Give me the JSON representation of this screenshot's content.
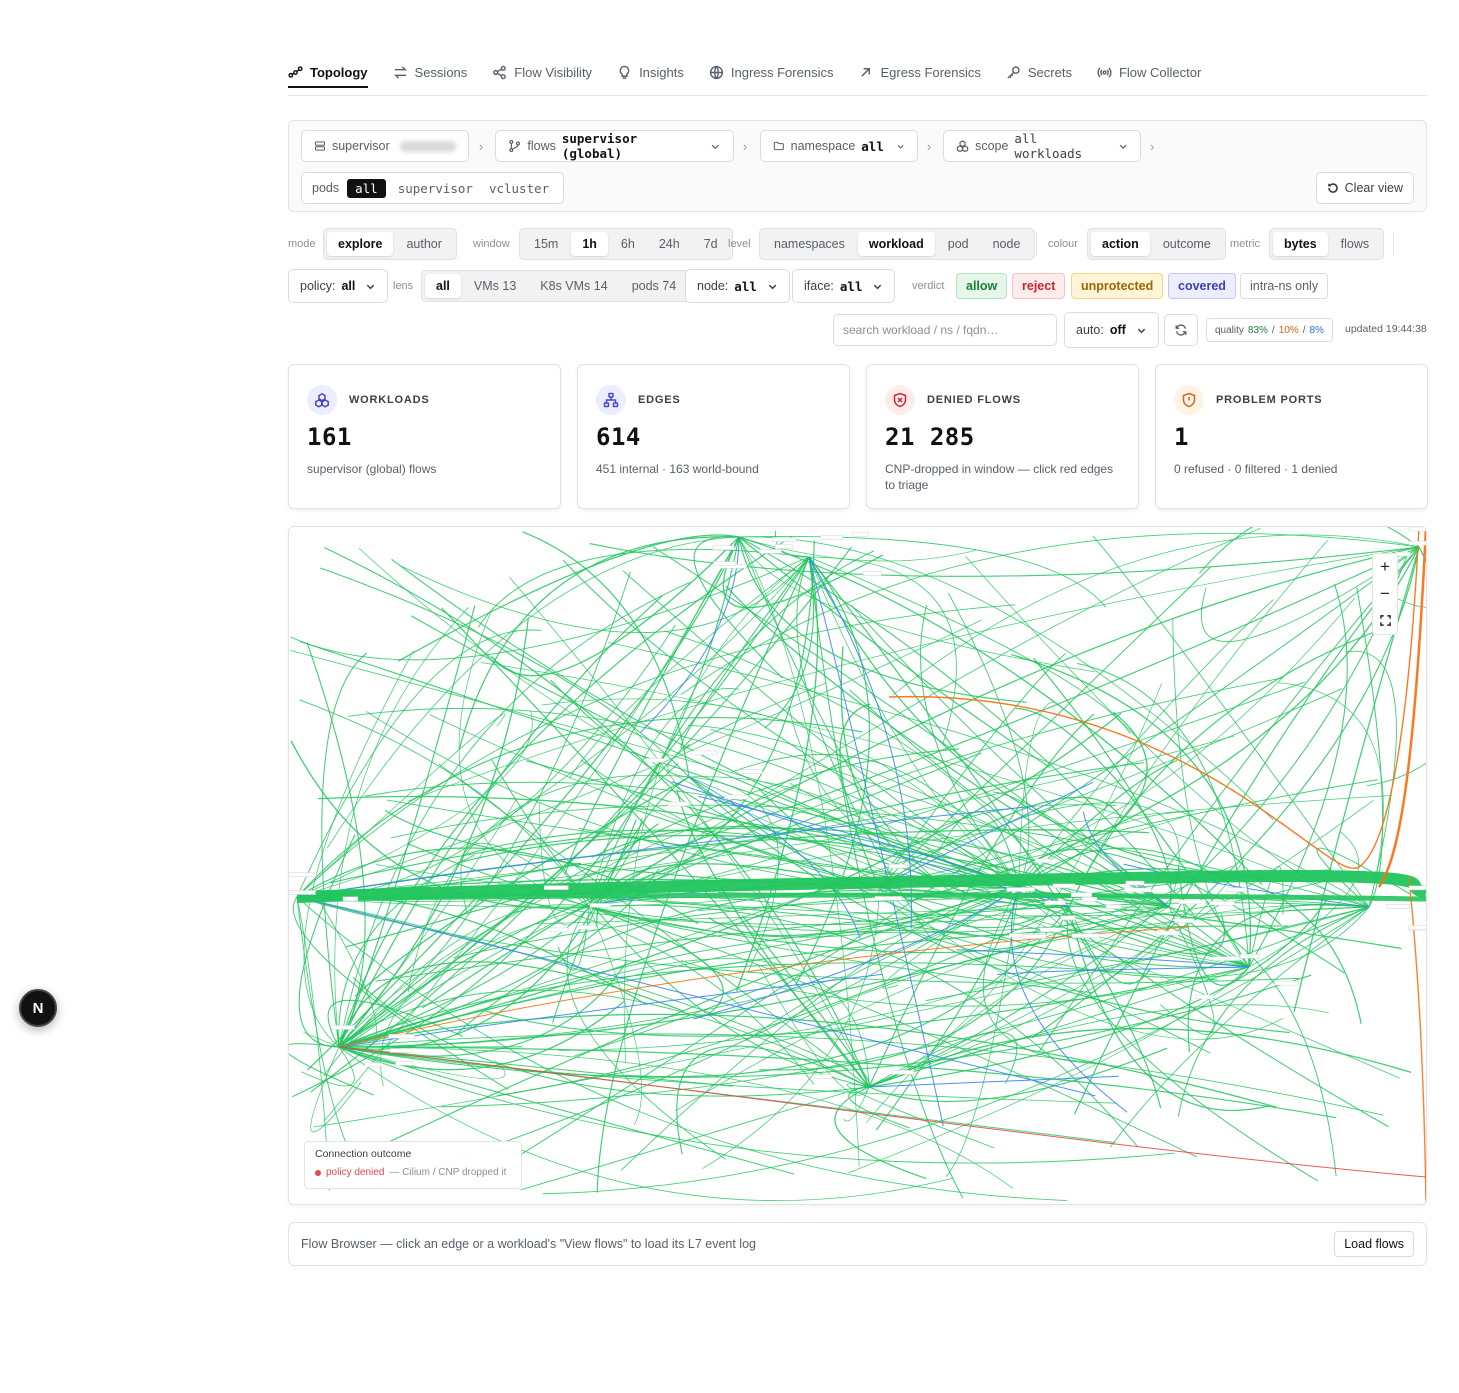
{
  "nav": {
    "tabs": [
      {
        "label": "Topology",
        "icon": "topology-icon",
        "active": true
      },
      {
        "label": "Sessions",
        "icon": "arrows-icon",
        "active": false
      },
      {
        "label": "Flow Visibility",
        "icon": "share-icon",
        "active": false
      },
      {
        "label": "Insights",
        "icon": "lightbulb-icon",
        "active": false
      },
      {
        "label": "Ingress Forensics",
        "icon": "globe-icon",
        "active": false
      },
      {
        "label": "Egress Forensics",
        "icon": "arrow-up-right-icon",
        "active": false
      },
      {
        "label": "Secrets",
        "icon": "key-icon",
        "active": false
      },
      {
        "label": "Flow Collector",
        "icon": "radio-icon",
        "active": false
      }
    ]
  },
  "scope": {
    "cluster_label": "supervisor",
    "flows_label": "flows",
    "flows_value": "supervisor (global)",
    "namespace_label": "namespace",
    "namespace_value": "all",
    "scope_label": "scope",
    "scope_value": "all workloads",
    "pods_label": "pods",
    "pods_options": [
      "all",
      "supervisor",
      "vcluster"
    ],
    "pods_selected": "all",
    "clear_label": "Clear view"
  },
  "controls": {
    "mode": {
      "label": "mode",
      "options": [
        "explore",
        "author"
      ],
      "selected": "explore"
    },
    "window": {
      "label": "window",
      "options": [
        "15m",
        "1h",
        "6h",
        "24h",
        "7d"
      ],
      "selected": "1h"
    },
    "level": {
      "label": "level",
      "options": [
        "namespaces",
        "workload",
        "pod",
        "node"
      ],
      "selected": "workload"
    },
    "colour": {
      "label": "colour",
      "options": [
        "action",
        "outcome"
      ],
      "selected": "action"
    },
    "metric": {
      "label": "metric",
      "options": [
        "bytes",
        "flows"
      ],
      "selected": "bytes"
    },
    "policy": {
      "label": "policy:",
      "value": "all"
    },
    "lens": {
      "label": "lens",
      "options": [
        "all",
        "VMs 13",
        "K8s VMs 14",
        "pods 74"
      ],
      "selected": "all"
    },
    "node": {
      "label": "node:",
      "value": "all"
    },
    "iface": {
      "label": "iface:",
      "value": "all"
    },
    "verdict": {
      "label": "verdict",
      "options": [
        {
          "label": "allow",
          "color": "#1a7f37",
          "bg": "#e6f6ea",
          "border": "#b5e3c2"
        },
        {
          "label": "reject",
          "color": "#cf222e",
          "bg": "#fdecec",
          "border": "#f5c2c2"
        },
        {
          "label": "unprotected",
          "color": "#9a6700",
          "bg": "#fff4d6",
          "border": "#f0d78a"
        },
        {
          "label": "covered",
          "color": "#3b3fb8",
          "bg": "#eceefe",
          "border": "#c3c7f4"
        },
        {
          "label": "intra-ns only",
          "color": "#57606a",
          "bg": "#ffffff",
          "border": "#dcdcdc"
        }
      ]
    },
    "search_placeholder": "search workload / ns / fqdn…",
    "auto_label": "auto:",
    "auto_value": "off",
    "quality_label": "quality",
    "quality_values": [
      {
        "v": "83%",
        "color": "#1a7f37"
      },
      {
        "v": "10%",
        "color": "#d4621a"
      },
      {
        "v": "8%",
        "color": "#2f6fd0"
      }
    ],
    "quality_sep": "/",
    "updated": "updated 19:44:38"
  },
  "cards": [
    {
      "label": "WORKLOADS",
      "value": "161",
      "sub": "supervisor (global) flows",
      "icon": "boxes-icon",
      "icon_color": "#4a46c9",
      "icon_bg": "#eceefe"
    },
    {
      "label": "EDGES",
      "value": "614",
      "sub": "451 internal · 163 world-bound",
      "icon": "network-icon",
      "icon_color": "#4a46c9",
      "icon_bg": "#eceefe"
    },
    {
      "label": "DENIED FLOWS",
      "value": "21 285",
      "sub": "CNP-dropped in window — click red edges to triage",
      "icon": "shield-x-icon",
      "icon_color": "#cf222e",
      "icon_bg": "#fdecec"
    },
    {
      "label": "PROBLEM PORTS",
      "value": "1",
      "sub": "0 refused · 0 filtered · 1 denied",
      "icon": "shield-alert-icon",
      "icon_color": "#d4621a",
      "icon_bg": "#fff4e5"
    }
  ],
  "graph": {
    "colors": {
      "allow": "#22c55e",
      "covered": "#3b82f6",
      "unprotected": "#f97316",
      "reject": "#ef4444"
    },
    "legend_title": "Connection outcome",
    "legend_item": "policy denied",
    "legend_desc": "— Cilium / CNP dropped it"
  },
  "browser": {
    "text": "Flow Browser — click an edge or a workload's \"View flows\" to load its L7 event log",
    "button": "Load flows"
  },
  "fab": "N"
}
